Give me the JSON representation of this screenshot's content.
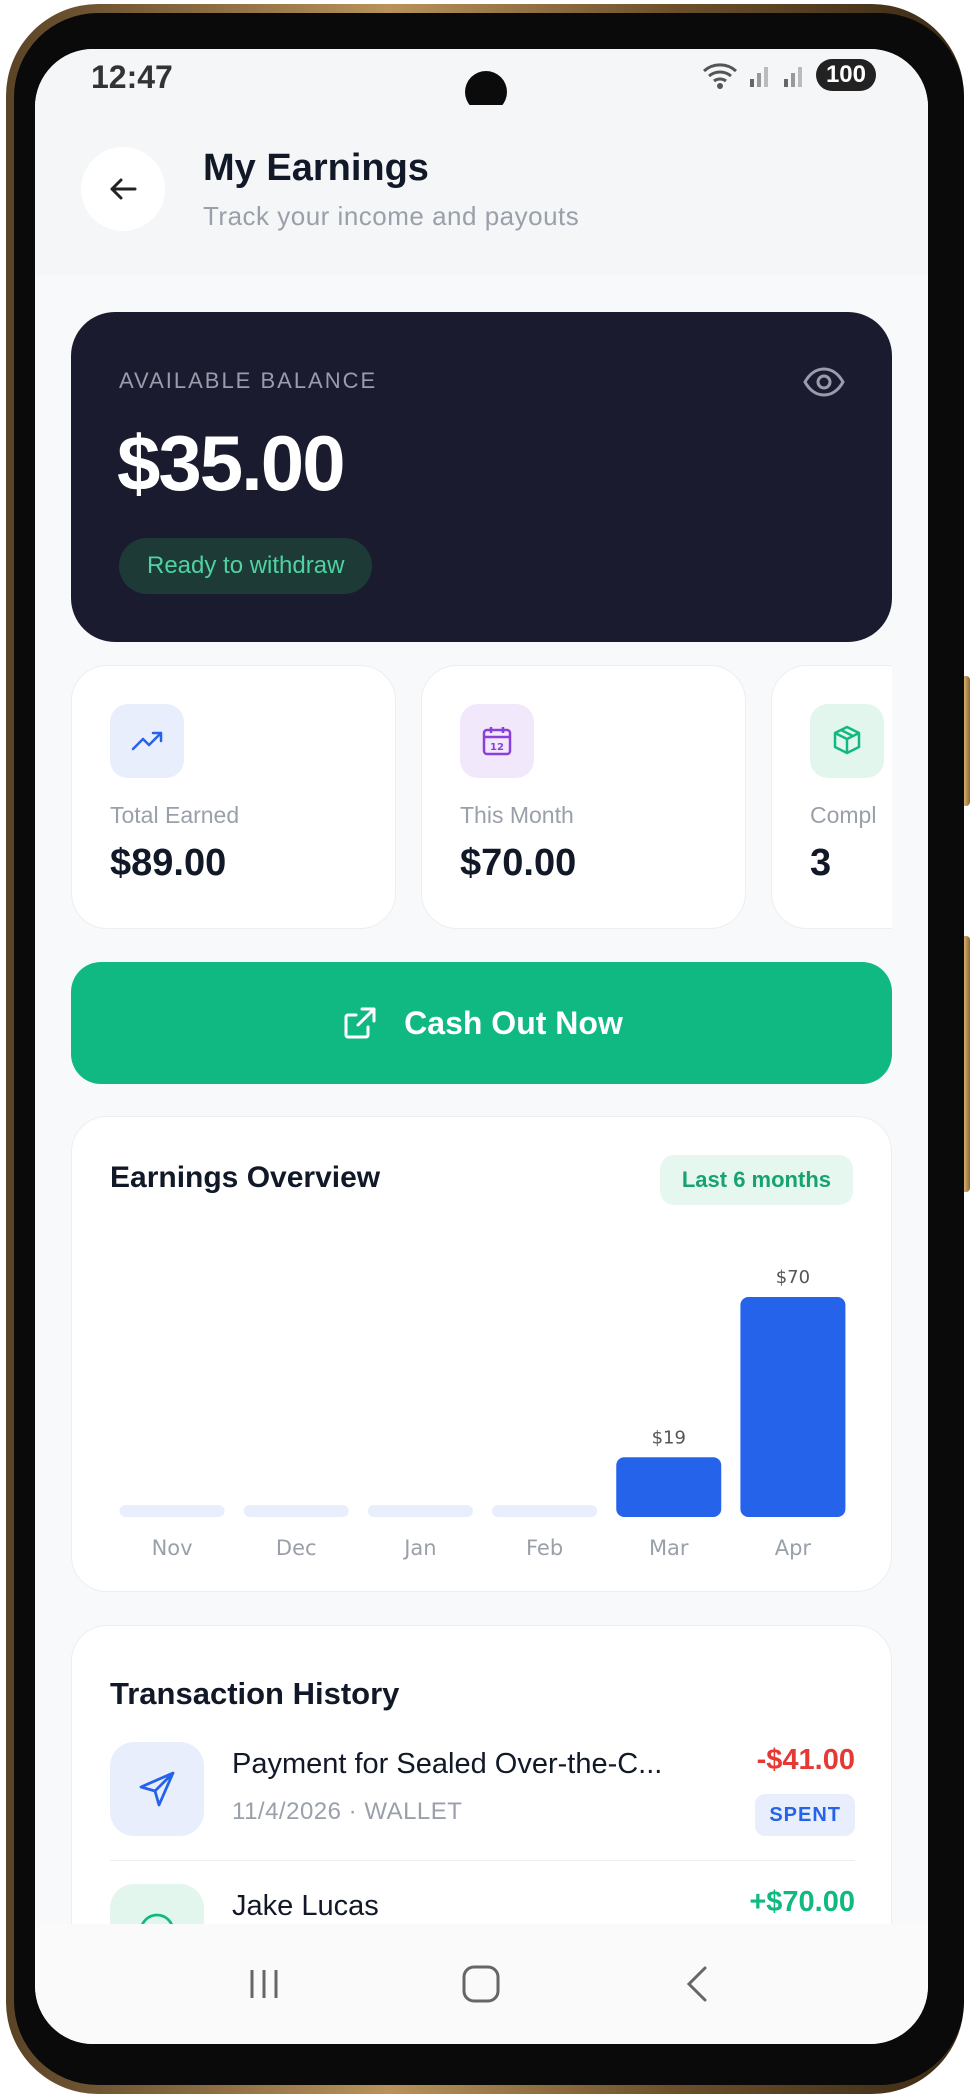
{
  "status_bar": {
    "time": "12:47",
    "battery": "100"
  },
  "header": {
    "title": "My Earnings",
    "subtitle": "Track your income and payouts"
  },
  "balance": {
    "label": "AVAILABLE BALANCE",
    "amount": "$35.00",
    "badge": "Ready to withdraw"
  },
  "stats": [
    {
      "label": "Total Earned",
      "value": "$89.00",
      "icon": "trending-up-icon",
      "color": "#e8eefc"
    },
    {
      "label": "This Month",
      "value": "$70.00",
      "icon": "calendar-icon",
      "color": "#f1e8fb"
    },
    {
      "label": "Compl",
      "value": "3",
      "icon": "package-icon",
      "color": "#e3f6ee"
    }
  ],
  "cashout": {
    "label": "Cash Out Now"
  },
  "chart": {
    "title": "Earnings Overview",
    "badge": "Last 6 months"
  },
  "chart_data": {
    "type": "bar",
    "title": "Earnings Overview",
    "categories": [
      "Nov",
      "Dec",
      "Jan",
      "Feb",
      "Mar",
      "Apr"
    ],
    "values": [
      0,
      0,
      0,
      0,
      19,
      70
    ],
    "data_labels": [
      "",
      "",
      "",
      "",
      "$19",
      "$70"
    ],
    "bar_color": "#2563eb",
    "empty_color": "#e8eefc"
  },
  "transactions": {
    "title": "Transaction History",
    "items": [
      {
        "name": "Payment for Sealed Over-the-C...",
        "meta": "11/4/2026 · WALLET",
        "amount": "-$41.00",
        "status": "SPENT",
        "icon": "send-icon"
      },
      {
        "name": "Jake Lucas",
        "meta": "",
        "amount": "+$70.00",
        "status": "",
        "icon": "check-circle-icon"
      }
    ]
  },
  "colors": {
    "accent": "#10b981",
    "dark_card": "#1a1b2e",
    "negative": "#e53935",
    "positive": "#10b981"
  }
}
